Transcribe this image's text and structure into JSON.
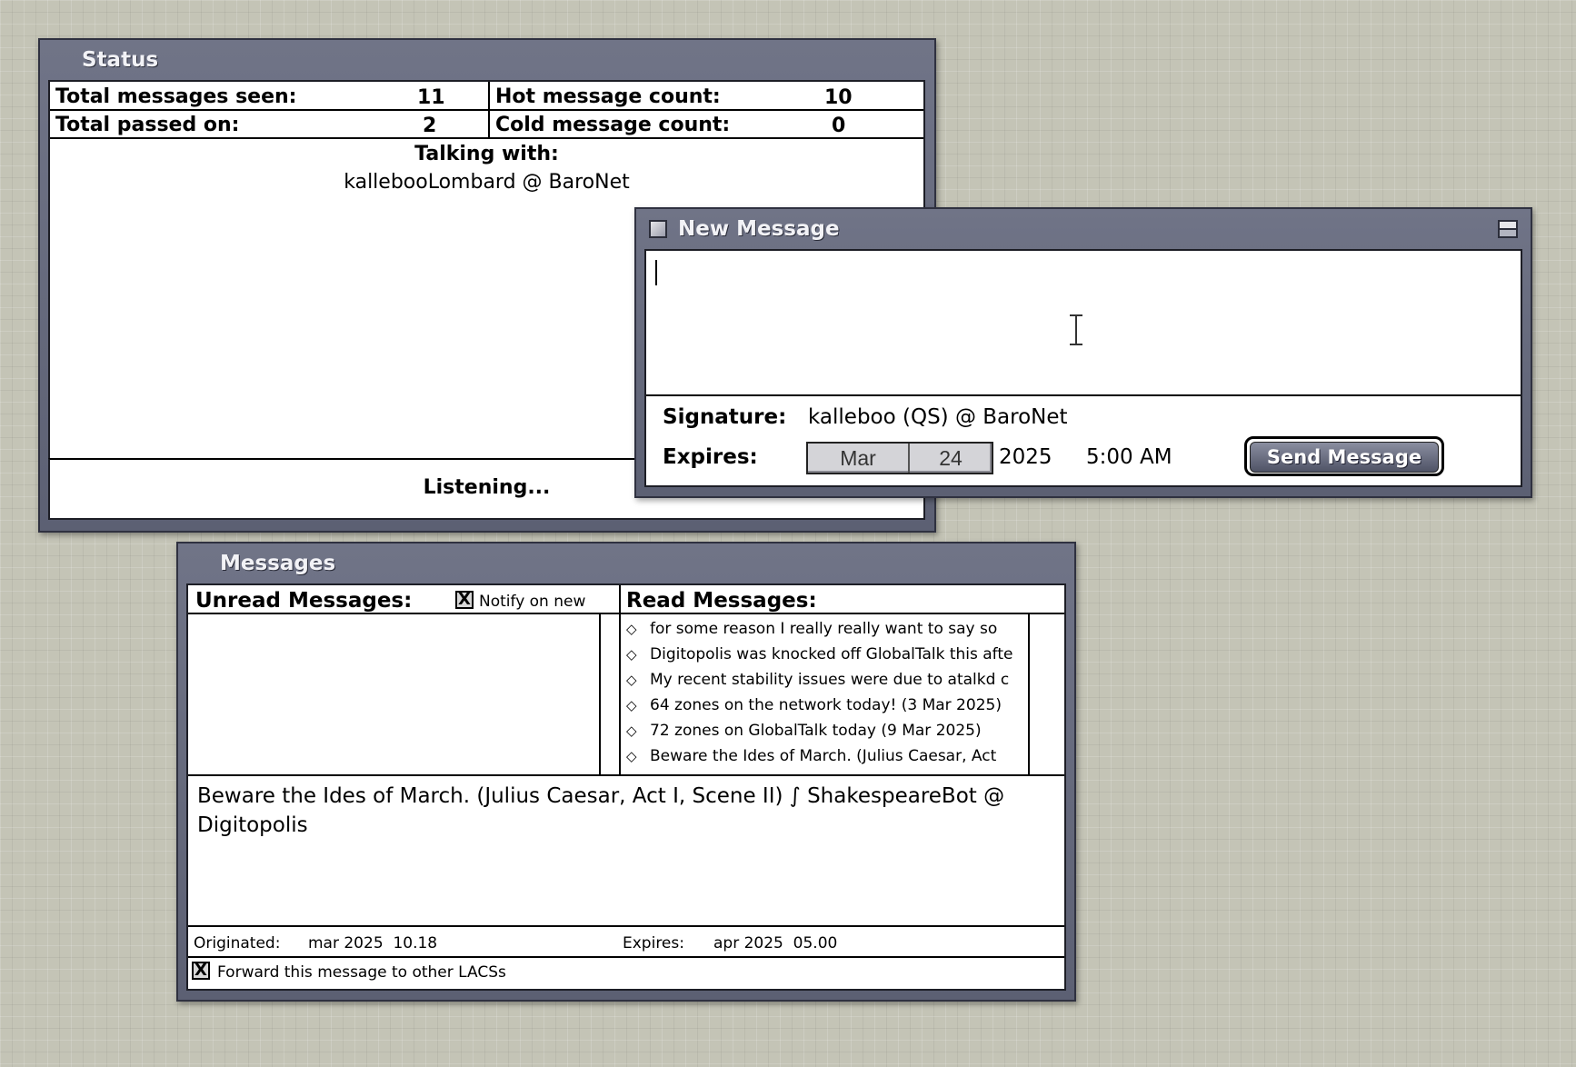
{
  "status_window": {
    "title": "Status",
    "total_seen_label": "Total messages seen:",
    "total_seen_value": "11",
    "hot_count_label": "Hot message count:",
    "hot_count_value": "10",
    "passed_on_label": "Total passed on:",
    "passed_on_value": "2",
    "cold_count_label": "Cold message count:",
    "cold_count_value": "0",
    "talking_with_label": "Talking with:",
    "talking_with_value": "kallebooLombard @ BaroNet",
    "status_text": "Listening..."
  },
  "new_message_window": {
    "title": "New Message",
    "body_value": "",
    "signature_label": "Signature:",
    "signature_value": "kalleboo (QS) @ BaroNet",
    "expires_label": "Expires:",
    "expires_month": "Mar",
    "expires_day": "24",
    "expires_year": "2025",
    "expires_time": "5:00 AM",
    "send_button_label": "Send Message"
  },
  "messages_window": {
    "title": "Messages",
    "unread_header": "Unread Messages:",
    "notify_label": "Notify on new",
    "notify_checked": "X",
    "read_header": "Read Messages:",
    "read_messages": [
      "for some reason I really really want to say so",
      "Digitopolis was knocked off GlobalTalk this afte",
      "My recent stability issues were due to atalkd c",
      "64 zones on the network today! (3 Mar 2025)",
      "72 zones on GlobalTalk today (9 Mar 2025)",
      "Beware the Ides of March. (Julius Caesar, Act"
    ],
    "selected_message_text": "Beware the Ides of March. (Julius Caesar, Act I, Scene II) ∫ ShakespeareBot @ Digitopolis",
    "originated_label": "Originated:",
    "originated_value": "mar 2025  10.18",
    "expires_label": "Expires:",
    "expires_value": "apr 2025  05.00",
    "forward_label": "Forward this message to other LACSs",
    "forward_checked": "X"
  },
  "icons": {
    "diamond": "◇",
    "close_box": "close-box-icon",
    "zoom_box": "zoom-box-icon",
    "ibeam": "ibeam-cursor-icon"
  }
}
